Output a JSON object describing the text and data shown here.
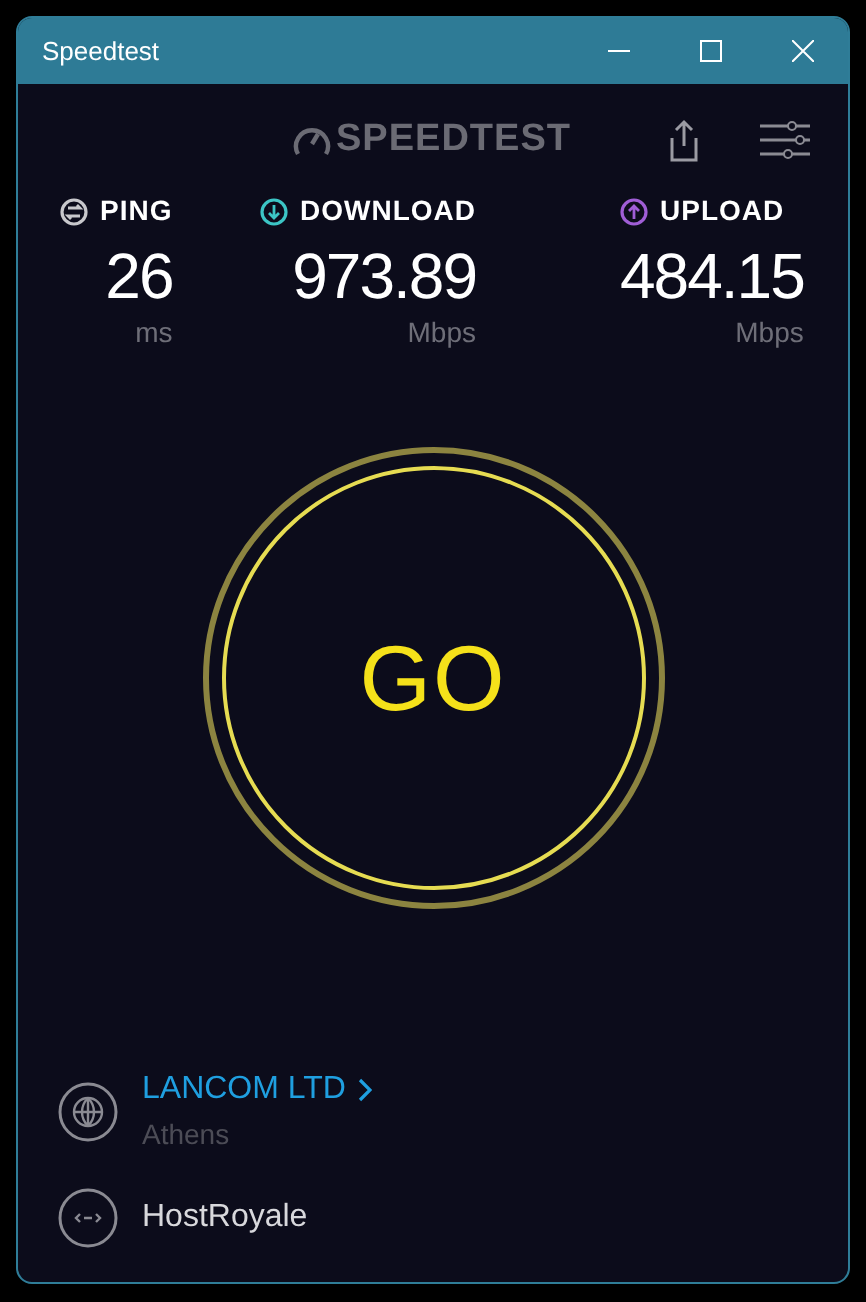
{
  "window": {
    "title": "Speedtest"
  },
  "logo": {
    "text": "SPEEDTEST"
  },
  "metrics": [
    {
      "kind": "ping",
      "label": "PING",
      "value": "26",
      "unit": "ms",
      "color": "#c8c8cc"
    },
    {
      "kind": "download",
      "label": "DOWNLOAD",
      "value": "973.89",
      "unit": "Mbps",
      "color": "#3cc5c5"
    },
    {
      "kind": "upload",
      "label": "UPLOAD",
      "value": "484.15",
      "unit": "Mbps",
      "color": "#a05ed6"
    }
  ],
  "go_button": {
    "label": "GO"
  },
  "servers": [
    {
      "kind": "isp",
      "name": "LANCOM LTD",
      "location": "Athens"
    },
    {
      "kind": "host",
      "name": "HostRoyale"
    }
  ]
}
